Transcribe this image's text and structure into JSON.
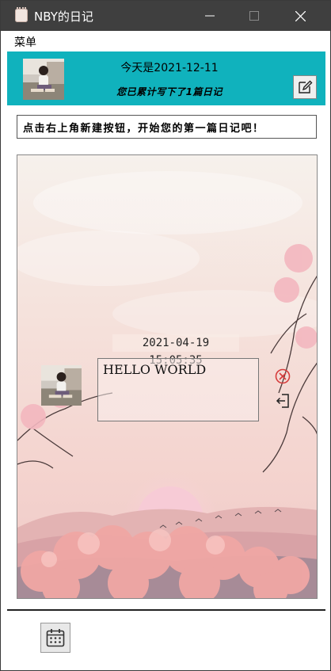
{
  "window": {
    "title": "NBY的日记",
    "icon": "notebook-icon"
  },
  "menubar": {
    "menu_label": "菜单"
  },
  "header": {
    "date_text": "今天是2021-12-11",
    "count_text": "您已累计写下了1篇日记",
    "edit_icon": "pencil-edit-icon",
    "colors": {
      "header_bg": "#10b2bd"
    }
  },
  "hint": {
    "text": "点击右上角新建按钮，开始您的第一篇日记吧！"
  },
  "entry": {
    "datetime": "2021-04-19 15:05:35",
    "content": "HELLO WORLD",
    "delete_icon": "delete-x-icon",
    "open_icon": "open-entry-icon"
  },
  "footer": {
    "calendar_icon": "calendar-icon"
  }
}
